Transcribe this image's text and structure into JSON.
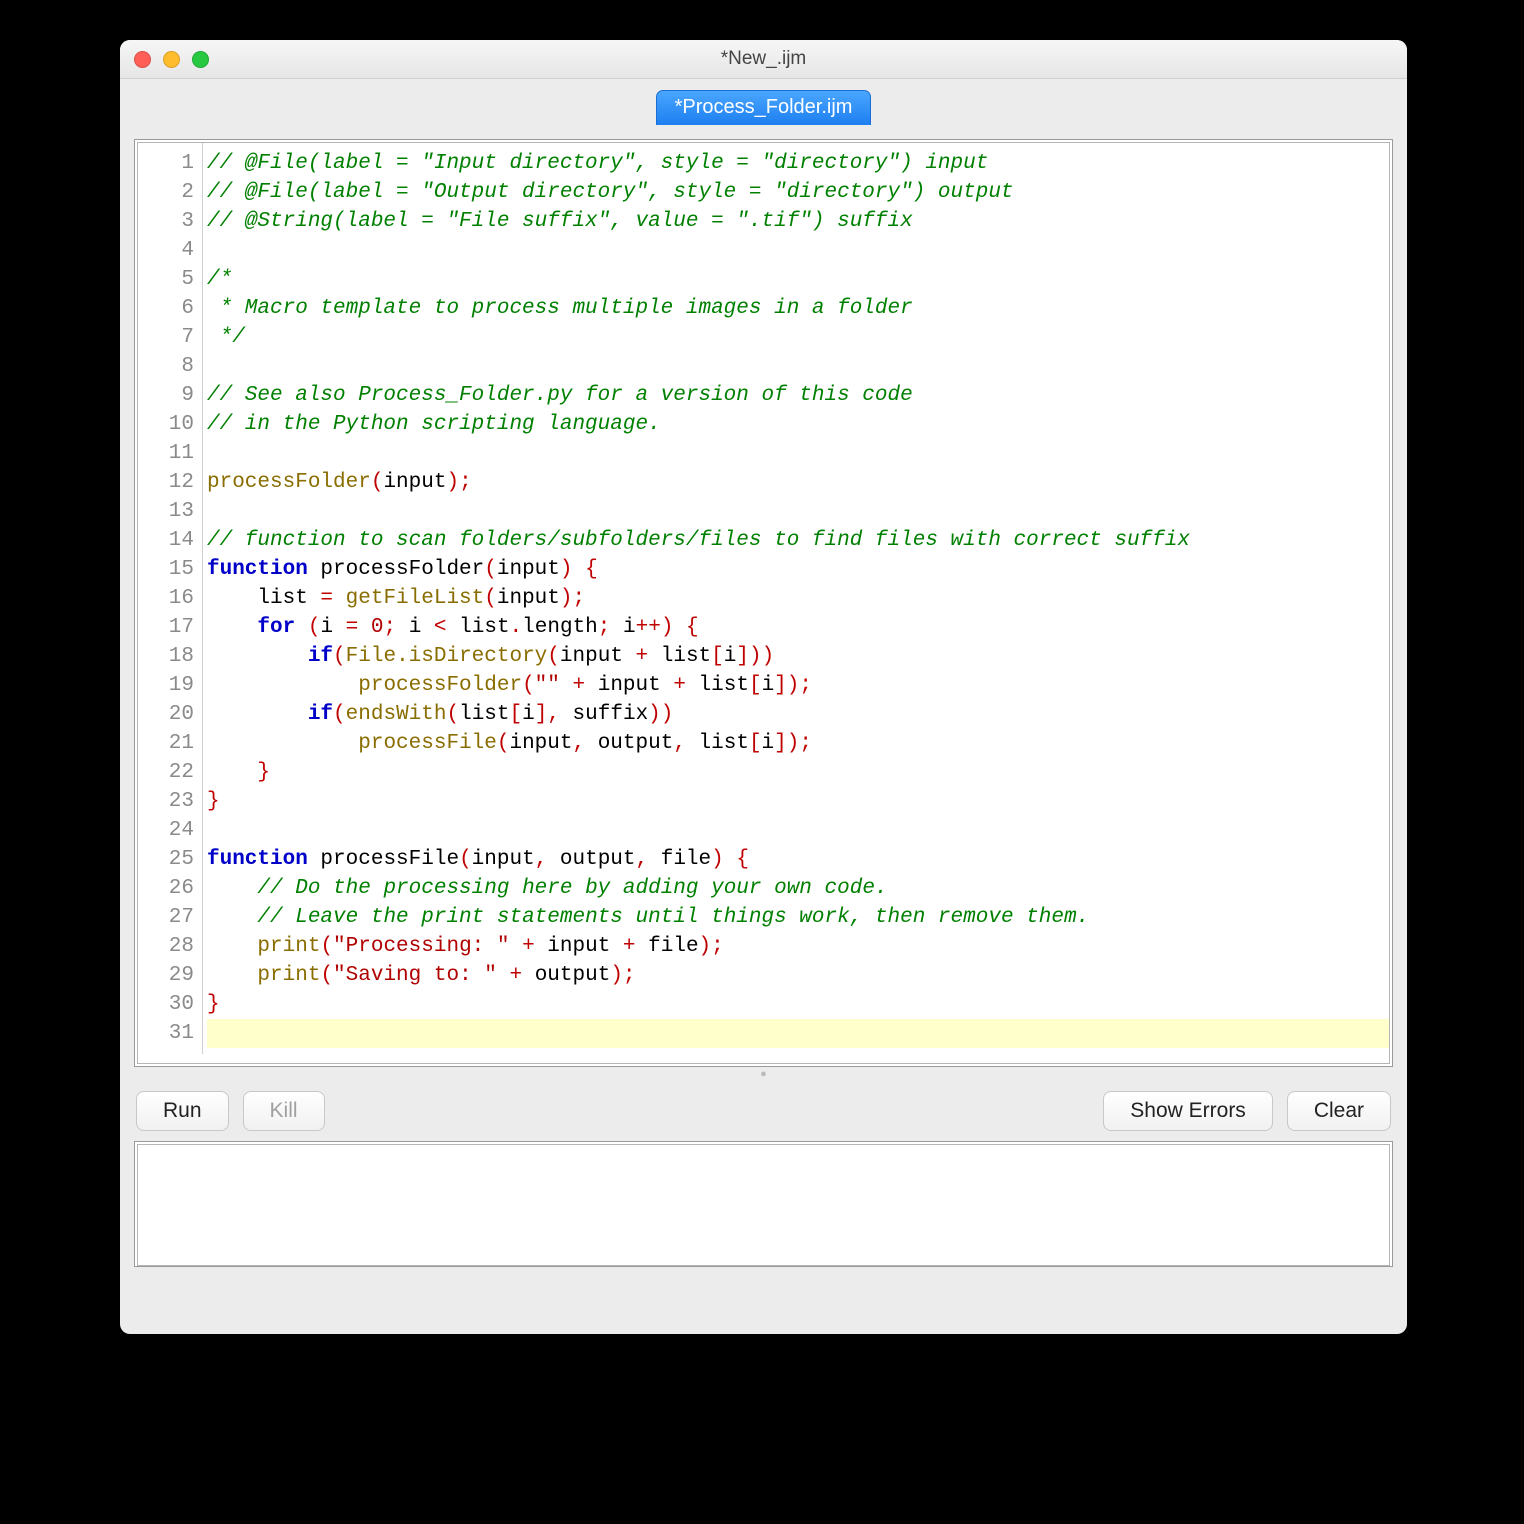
{
  "window": {
    "title": "*New_.ijm",
    "tab": "*Process_Folder.ijm"
  },
  "buttons": {
    "run": "Run",
    "kill": "Kill",
    "show_errors": "Show Errors",
    "clear": "Clear"
  },
  "editor": {
    "highlight_line": 31,
    "lines": [
      [
        {
          "t": "c",
          "v": "// @File(label = \"Input directory\", style = \"directory\") input"
        }
      ],
      [
        {
          "t": "c",
          "v": "// @File(label = \"Output directory\", style = \"directory\") output"
        }
      ],
      [
        {
          "t": "c",
          "v": "// @String(label = \"File suffix\", value = \".tif\") suffix"
        }
      ],
      [],
      [
        {
          "t": "c",
          "v": "/*"
        }
      ],
      [
        {
          "t": "c",
          "v": " * Macro template to process multiple images in a folder"
        }
      ],
      [
        {
          "t": "c",
          "v": " */"
        }
      ],
      [],
      [
        {
          "t": "c",
          "v": "// See also Process_Folder.py for a version of this code"
        }
      ],
      [
        {
          "t": "c",
          "v": "// in the Python scripting language."
        }
      ],
      [],
      [
        {
          "t": "fn",
          "v": "processFolder"
        },
        {
          "t": "br",
          "v": "("
        },
        {
          "t": "p",
          "v": "input"
        },
        {
          "t": "br",
          "v": ")"
        },
        {
          "t": "op",
          "v": ";"
        }
      ],
      [],
      [
        {
          "t": "c",
          "v": "// function to scan folders/subfolders/files to find files with correct suffix"
        }
      ],
      [
        {
          "t": "k",
          "v": "function"
        },
        {
          "t": "p",
          "v": " processFolder"
        },
        {
          "t": "br",
          "v": "("
        },
        {
          "t": "p",
          "v": "input"
        },
        {
          "t": "br",
          "v": ") {"
        }
      ],
      [
        {
          "t": "p",
          "v": "    list "
        },
        {
          "t": "op",
          "v": "="
        },
        {
          "t": "p",
          "v": " "
        },
        {
          "t": "fn",
          "v": "getFileList"
        },
        {
          "t": "br",
          "v": "("
        },
        {
          "t": "p",
          "v": "input"
        },
        {
          "t": "br",
          "v": ")"
        },
        {
          "t": "op",
          "v": ";"
        }
      ],
      [
        {
          "t": "p",
          "v": "    "
        },
        {
          "t": "k",
          "v": "for"
        },
        {
          "t": "p",
          "v": " "
        },
        {
          "t": "br",
          "v": "("
        },
        {
          "t": "p",
          "v": "i "
        },
        {
          "t": "op",
          "v": "="
        },
        {
          "t": "p",
          "v": " "
        },
        {
          "t": "n",
          "v": "0"
        },
        {
          "t": "op",
          "v": ";"
        },
        {
          "t": "p",
          "v": " i "
        },
        {
          "t": "op",
          "v": "<"
        },
        {
          "t": "p",
          "v": " list"
        },
        {
          "t": "op",
          "v": "."
        },
        {
          "t": "p",
          "v": "length"
        },
        {
          "t": "op",
          "v": ";"
        },
        {
          "t": "p",
          "v": " i"
        },
        {
          "t": "op",
          "v": "++"
        },
        {
          "t": "br",
          "v": ") {"
        }
      ],
      [
        {
          "t": "p",
          "v": "        "
        },
        {
          "t": "k",
          "v": "if"
        },
        {
          "t": "br",
          "v": "("
        },
        {
          "t": "fn",
          "v": "File.isDirectory"
        },
        {
          "t": "br",
          "v": "("
        },
        {
          "t": "p",
          "v": "input "
        },
        {
          "t": "op",
          "v": "+"
        },
        {
          "t": "p",
          "v": " list"
        },
        {
          "t": "br",
          "v": "["
        },
        {
          "t": "p",
          "v": "i"
        },
        {
          "t": "br",
          "v": "]))"
        }
      ],
      [
        {
          "t": "p",
          "v": "            "
        },
        {
          "t": "fn",
          "v": "processFolder"
        },
        {
          "t": "br",
          "v": "("
        },
        {
          "t": "s",
          "v": "\"\""
        },
        {
          "t": "p",
          "v": " "
        },
        {
          "t": "op",
          "v": "+"
        },
        {
          "t": "p",
          "v": " input "
        },
        {
          "t": "op",
          "v": "+"
        },
        {
          "t": "p",
          "v": " list"
        },
        {
          "t": "br",
          "v": "["
        },
        {
          "t": "p",
          "v": "i"
        },
        {
          "t": "br",
          "v": "])"
        },
        {
          "t": "op",
          "v": ";"
        }
      ],
      [
        {
          "t": "p",
          "v": "        "
        },
        {
          "t": "k",
          "v": "if"
        },
        {
          "t": "br",
          "v": "("
        },
        {
          "t": "fn",
          "v": "endsWith"
        },
        {
          "t": "br",
          "v": "("
        },
        {
          "t": "p",
          "v": "list"
        },
        {
          "t": "br",
          "v": "["
        },
        {
          "t": "p",
          "v": "i"
        },
        {
          "t": "br",
          "v": "]"
        },
        {
          "t": "op",
          "v": ","
        },
        {
          "t": "p",
          "v": " suffix"
        },
        {
          "t": "br",
          "v": "))"
        }
      ],
      [
        {
          "t": "p",
          "v": "            "
        },
        {
          "t": "fn",
          "v": "processFile"
        },
        {
          "t": "br",
          "v": "("
        },
        {
          "t": "p",
          "v": "input"
        },
        {
          "t": "op",
          "v": ","
        },
        {
          "t": "p",
          "v": " output"
        },
        {
          "t": "op",
          "v": ","
        },
        {
          "t": "p",
          "v": " list"
        },
        {
          "t": "br",
          "v": "["
        },
        {
          "t": "p",
          "v": "i"
        },
        {
          "t": "br",
          "v": "])"
        },
        {
          "t": "op",
          "v": ";"
        }
      ],
      [
        {
          "t": "p",
          "v": "    "
        },
        {
          "t": "br",
          "v": "}"
        }
      ],
      [
        {
          "t": "br",
          "v": "}"
        }
      ],
      [],
      [
        {
          "t": "k",
          "v": "function"
        },
        {
          "t": "p",
          "v": " processFile"
        },
        {
          "t": "br",
          "v": "("
        },
        {
          "t": "p",
          "v": "input"
        },
        {
          "t": "op",
          "v": ","
        },
        {
          "t": "p",
          "v": " output"
        },
        {
          "t": "op",
          "v": ","
        },
        {
          "t": "p",
          "v": " file"
        },
        {
          "t": "br",
          "v": ") {"
        }
      ],
      [
        {
          "t": "p",
          "v": "    "
        },
        {
          "t": "c",
          "v": "// Do the processing here by adding your own code."
        }
      ],
      [
        {
          "t": "p",
          "v": "    "
        },
        {
          "t": "c",
          "v": "// Leave the print statements until things work, then remove them."
        }
      ],
      [
        {
          "t": "p",
          "v": "    "
        },
        {
          "t": "fn",
          "v": "print"
        },
        {
          "t": "br",
          "v": "("
        },
        {
          "t": "s",
          "v": "\"Processing: \""
        },
        {
          "t": "p",
          "v": " "
        },
        {
          "t": "op",
          "v": "+"
        },
        {
          "t": "p",
          "v": " input "
        },
        {
          "t": "op",
          "v": "+"
        },
        {
          "t": "p",
          "v": " file"
        },
        {
          "t": "br",
          "v": ")"
        },
        {
          "t": "op",
          "v": ";"
        }
      ],
      [
        {
          "t": "p",
          "v": "    "
        },
        {
          "t": "fn",
          "v": "print"
        },
        {
          "t": "br",
          "v": "("
        },
        {
          "t": "s",
          "v": "\"Saving to: \""
        },
        {
          "t": "p",
          "v": " "
        },
        {
          "t": "op",
          "v": "+"
        },
        {
          "t": "p",
          "v": " output"
        },
        {
          "t": "br",
          "v": ")"
        },
        {
          "t": "op",
          "v": ";"
        }
      ],
      [
        {
          "t": "br",
          "v": "}"
        }
      ],
      []
    ]
  }
}
